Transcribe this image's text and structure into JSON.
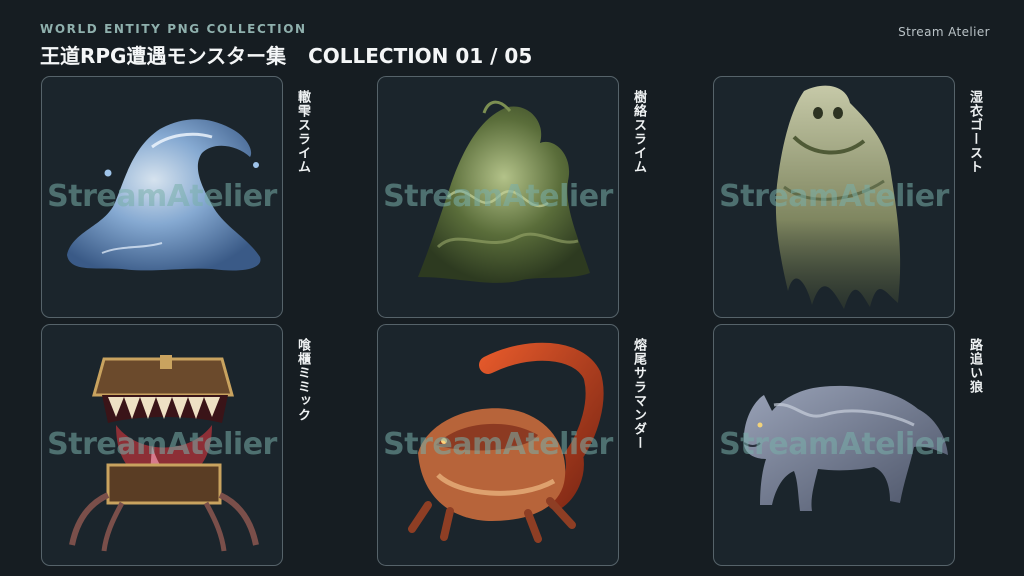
{
  "header": {
    "eyebrow": "WORLD ENTITY PNG COLLECTION",
    "title": "王道RPG遭遇モンスター集",
    "collection": "COLLECTION 01 / 05",
    "brand": "Stream Atelier"
  },
  "watermark": "StreamAtelier",
  "cards": [
    {
      "name": "轍雫スライム",
      "icon": "blue-water-slime"
    },
    {
      "name": "樹絡スライム",
      "icon": "green-vine-slime"
    },
    {
      "name": "湿衣ゴースト",
      "icon": "moss-cloth-ghost"
    },
    {
      "name": "喰櫃ミミック",
      "icon": "treasure-chest-mimic"
    },
    {
      "name": "熔尾サラマンダー",
      "icon": "lava-salamander"
    },
    {
      "name": "路追い狼",
      "icon": "grey-wolf"
    }
  ],
  "colors": {
    "background": "#161d22",
    "card_border": "#56636a",
    "eyebrow": "#8fb0ad",
    "watermark": "#78afaa"
  }
}
